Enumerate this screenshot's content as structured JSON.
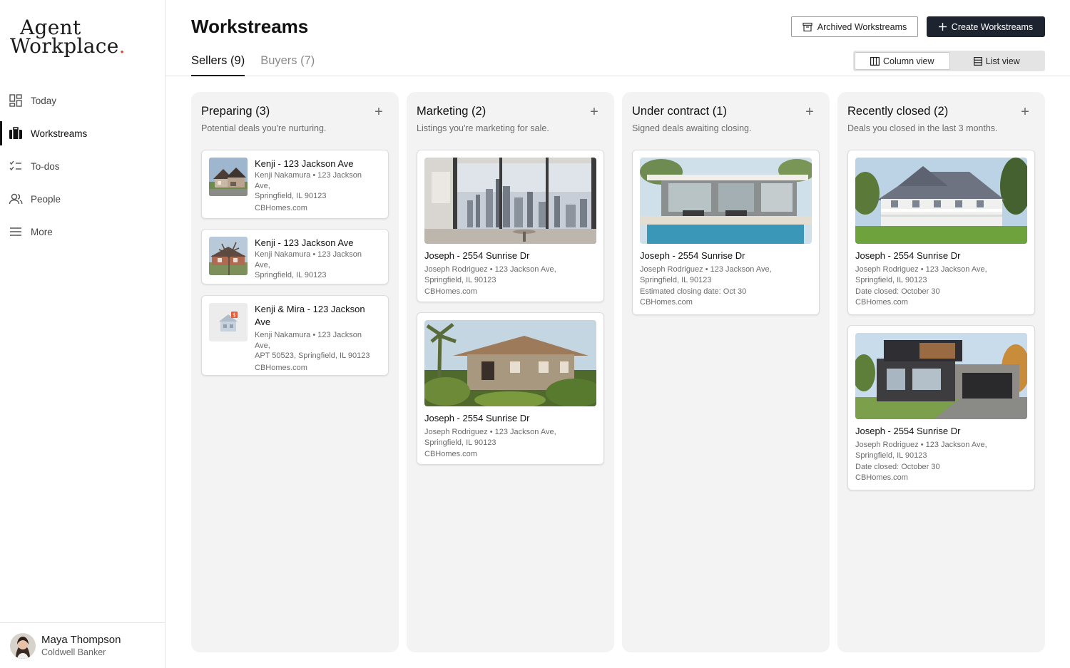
{
  "app": {
    "logo_line1": "Agent",
    "logo_line2": "Workplace",
    "logo_dot": "."
  },
  "sidebar": {
    "items": [
      {
        "label": "Today",
        "icon": "dashboard-icon"
      },
      {
        "label": "Workstreams",
        "icon": "briefcase-icon"
      },
      {
        "label": "To-dos",
        "icon": "checklist-icon"
      },
      {
        "label": "People",
        "icon": "people-icon"
      },
      {
        "label": "More",
        "icon": "menu-icon"
      }
    ],
    "active_index": 1,
    "user": {
      "name": "Maya Thompson",
      "org": "Coldwell Banker"
    }
  },
  "header": {
    "title": "Workstreams",
    "archived_label": "Archived Workstreams",
    "create_label": "Create Workstreams",
    "tabs": [
      {
        "label": "Sellers (9)",
        "active": true
      },
      {
        "label": "Buyers (7)",
        "active": false
      }
    ],
    "views": [
      {
        "label": "Column view",
        "active": true
      },
      {
        "label": "List view",
        "active": false
      }
    ]
  },
  "columns": [
    {
      "title": "Preparing (3)",
      "subtitle": "Potential deals you're nurturing.",
      "cards": [
        {
          "title": "Kenji - 123 Jackson Ave",
          "meta1": "Kenji Nakamura • 123 Jackson",
          "meta2": "Ave,",
          "meta3": "Springfield, IL 90123",
          "site": "CBHomes.com"
        },
        {
          "title": "Kenji - 123 Jackson Ave",
          "meta1": "Kenji Nakamura • 123 Jackson",
          "meta2": "Ave,",
          "meta3": "Springfield, IL 90123"
        },
        {
          "title_line1": "Kenji & Mira - 123 Jackson",
          "title_line2": "Ave",
          "meta1": "Kenji Nakamura • 123 Jackson",
          "meta2": "Ave,",
          "meta3": "APT 50523, Springfield, IL 90123",
          "site": "CBHomes.com"
        }
      ]
    },
    {
      "title": "Marketing (2)",
      "subtitle": "Listings you're marketing for sale.",
      "cards": [
        {
          "title": "Joseph - 2554 Sunrise Dr",
          "meta1": "Joseph Rodriguez  • 123 Jackson Ave,",
          "meta2": "Springfield, IL 90123",
          "site": "CBHomes.com"
        },
        {
          "title": "Joseph - 2554 Sunrise Dr",
          "meta1": "Joseph Rodriguez  • 123 Jackson Ave,",
          "meta2": "Springfield, IL 90123",
          "site": "CBHomes.com"
        }
      ]
    },
    {
      "title": "Under contract (1)",
      "subtitle": "Signed deals awaiting closing.",
      "cards": [
        {
          "title": "Joseph - 2554 Sunrise Dr",
          "meta1": "Joseph Rodriguez  • 123 Jackson Ave,",
          "meta2": "Springfield, IL 90123",
          "extra": "Estimated closing date: Oct 30",
          "site": "CBHomes.com"
        }
      ]
    },
    {
      "title": "Recently closed (2)",
      "subtitle": "Deals you closed in the last 3 months.",
      "cards": [
        {
          "title": "Joseph - 2554 Sunrise Dr",
          "meta1": "Joseph Rodriguez  • 123 Jackson Ave,",
          "meta2": "Springfield, IL 90123",
          "extra": "Date closed: October 30",
          "site": "CBHomes.com"
        },
        {
          "title": "Joseph - 2554 Sunrise Dr",
          "meta1": "Joseph Rodriguez  • 123 Jackson Ave,",
          "meta2": "Springfield, IL 90123",
          "extra": "Date closed: October 30",
          "site": "CBHomes.com"
        }
      ]
    }
  ]
}
